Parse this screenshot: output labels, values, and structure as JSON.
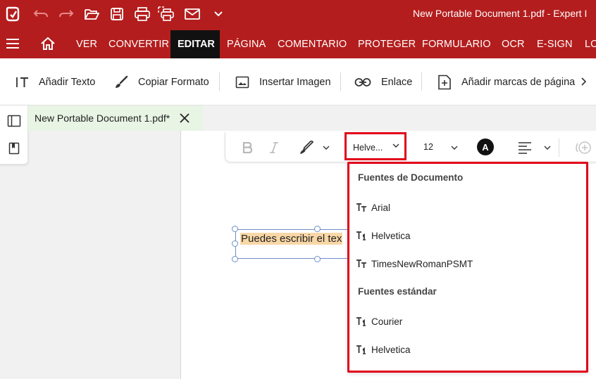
{
  "titlebar": {
    "title": "New Portable Document 1.pdf   -   Expert I",
    "bg_color": "#b41d1d",
    "icons": [
      "app-logo-icon",
      "undo-icon",
      "redo-icon",
      "open-folder-icon",
      "save-icon",
      "print-icon",
      "batch-print-icon",
      "email-icon",
      "more-chevron-icon"
    ]
  },
  "menubar": {
    "items": [
      "VER",
      "CONVERTIR",
      "EDITAR",
      "PÁGINA",
      "COMENTARIO",
      "PROTEGER",
      "FORMULARIO",
      "OCR",
      "E-SIGN",
      "LO"
    ],
    "active": "EDITAR"
  },
  "toolbar": {
    "add_text": "Añadir Texto",
    "copy_format": "Copiar Formato",
    "insert_image": "Insertar Imagen",
    "link": "Enlace",
    "add_bookmarks": "Añadir marcas de página"
  },
  "tab": {
    "label": "New Portable Document 1.pdf*"
  },
  "formatbar": {
    "font_value": "Helve...",
    "size_value": "12",
    "color_letter": "A"
  },
  "page": {
    "text": "Puedes escribir el tex"
  },
  "dropdown": {
    "doc_fonts_header": "Fuentes de Documento",
    "doc_fonts": [
      {
        "name": "Arial",
        "icon": "truetype-font-icon"
      },
      {
        "name": "Helvetica",
        "icon": "type1-font-icon"
      },
      {
        "name": "TimesNewRomanPSMT",
        "icon": "truetype-font-icon"
      }
    ],
    "std_fonts_header": "Fuentes estándar",
    "std_fonts": [
      {
        "name": "Courier",
        "icon": "type1-font-icon"
      },
      {
        "name": "Helvetica",
        "icon": "type1-font-icon"
      }
    ],
    "highlight_color": "#e0001a"
  }
}
